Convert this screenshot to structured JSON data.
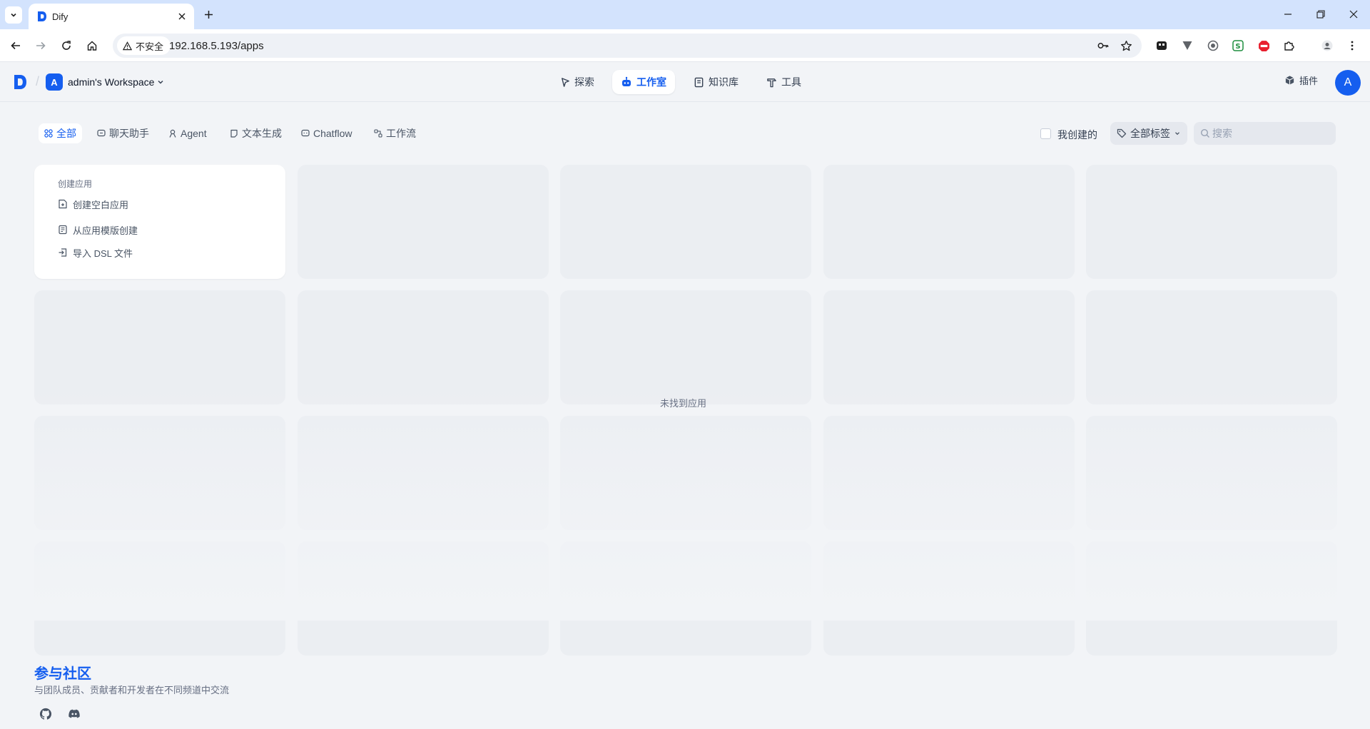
{
  "browser": {
    "tab_title": "Dify",
    "security_label": "不安全",
    "url": "192.168.5.193/apps"
  },
  "header": {
    "workspace_initial": "A",
    "workspace_name": "admin's Workspace",
    "nav": [
      {
        "label": "探索",
        "icon": "compass-icon",
        "active": false
      },
      {
        "label": "工作室",
        "icon": "robot-icon",
        "active": true
      },
      {
        "label": "知识库",
        "icon": "book-icon",
        "active": false
      },
      {
        "label": "工具",
        "icon": "hammer-icon",
        "active": false
      }
    ],
    "plugins_label": "插件",
    "user_initial": "A"
  },
  "filters": {
    "tabs": [
      {
        "label": "全部",
        "icon": "grid-icon",
        "active": true
      },
      {
        "label": "聊天助手",
        "icon": "chat-icon",
        "active": false
      },
      {
        "label": "Agent",
        "icon": "agent-icon",
        "active": false
      },
      {
        "label": "文本生成",
        "icon": "text-icon",
        "active": false
      },
      {
        "label": "Chatflow",
        "icon": "chatflow-icon",
        "active": false
      },
      {
        "label": "工作流",
        "icon": "workflow-icon",
        "active": false
      }
    ],
    "mine_label": "我创建的",
    "mine_checked": false,
    "tags_label": "全部标签",
    "search_placeholder": "搜索"
  },
  "create_card": {
    "title": "创建应用",
    "items": [
      {
        "label": "创建空白应用",
        "icon": "file-plus-icon"
      },
      {
        "label": "从应用模版创建",
        "icon": "template-icon"
      },
      {
        "label": "导入 DSL 文件",
        "icon": "import-icon"
      }
    ]
  },
  "empty_state": "未找到应用",
  "footer": {
    "title": "参与社区",
    "description": "与团队成员、贡献者和开发者在不同频道中交流"
  },
  "colors": {
    "accent": "#155eef",
    "background": "#f2f4f7",
    "placeholder_card": "#ebeef2"
  }
}
